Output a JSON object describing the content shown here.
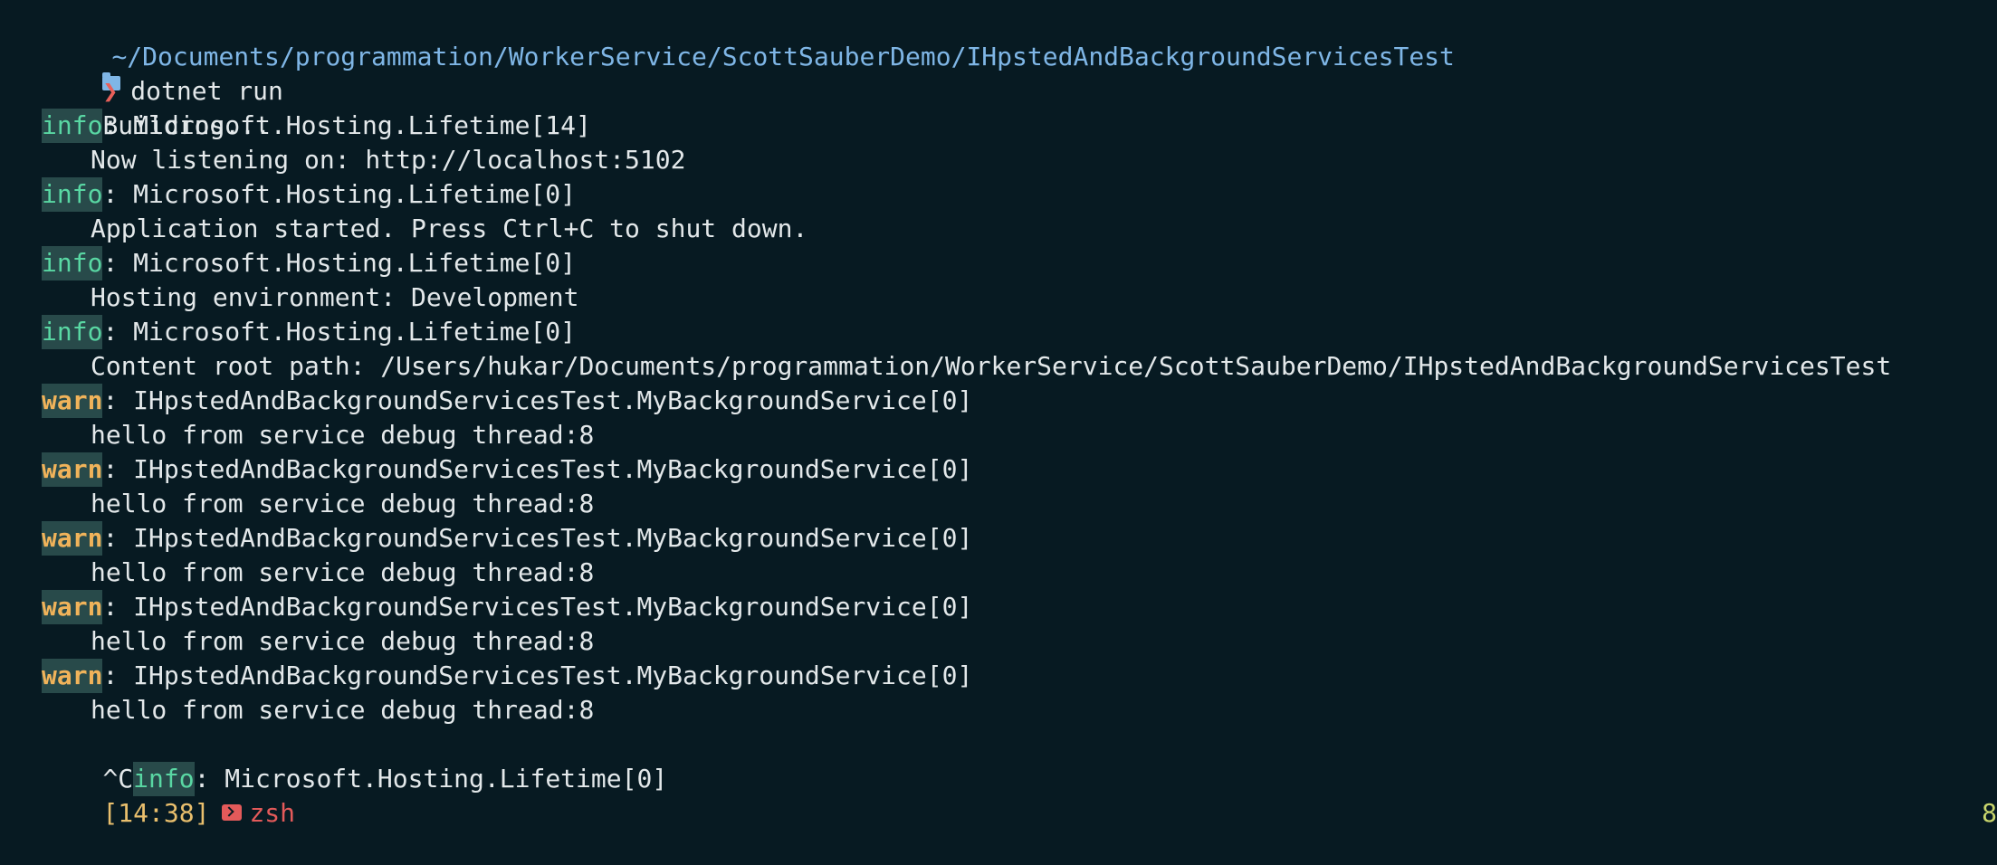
{
  "prompt": {
    "cwd": "~/Documents/programmation/WorkerService/ScottSauberDemo/IHpstedAndBackgroundServicesTest",
    "chevron": "❯",
    "command": "dotnet run"
  },
  "output": {
    "building": "Building...",
    "entries": [
      {
        "level": "info",
        "source": ": Microsoft.Hosting.Lifetime[14]",
        "message": "Now listening on: http://localhost:5102"
      },
      {
        "level": "info",
        "source": ": Microsoft.Hosting.Lifetime[0]",
        "message": "Application started. Press Ctrl+C to shut down."
      },
      {
        "level": "info",
        "source": ": Microsoft.Hosting.Lifetime[0]",
        "message": "Hosting environment: Development"
      },
      {
        "level": "info",
        "source": ": Microsoft.Hosting.Lifetime[0]",
        "message": "Content root path: /Users/hukar/Documents/programmation/WorkerService/ScottSauberDemo/IHpstedAndBackgroundServicesTest"
      },
      {
        "level": "warn",
        "source": ": IHpstedAndBackgroundServicesTest.MyBackgroundService[0]",
        "message": "hello from service debug thread:8"
      },
      {
        "level": "warn",
        "source": ": IHpstedAndBackgroundServicesTest.MyBackgroundService[0]",
        "message": "hello from service debug thread:8"
      },
      {
        "level": "warn",
        "source": ": IHpstedAndBackgroundServicesTest.MyBackgroundService[0]",
        "message": "hello from service debug thread:8"
      },
      {
        "level": "warn",
        "source": ": IHpstedAndBackgroundServicesTest.MyBackgroundService[0]",
        "message": "hello from service debug thread:8"
      },
      {
        "level": "warn",
        "source": ": IHpstedAndBackgroundServicesTest.MyBackgroundService[0]",
        "message": "hello from service debug thread:8"
      }
    ],
    "interrupt": {
      "prefix": "^C",
      "level": "info",
      "source": ": Microsoft.Hosting.Lifetime[0]"
    }
  },
  "status_bar": {
    "time": "[14:38]",
    "shell": "zsh",
    "right_value": "8"
  },
  "colors": {
    "background": "#071a22",
    "info": "#59d7a3",
    "warn": "#f0b35a",
    "path": "#7fb6e6",
    "accent_red": "#e35a5a"
  },
  "icons": {
    "folder": "folder-icon",
    "status_dot": "status-dot-icon",
    "prompt": "chevron-right-icon",
    "shell": "terminal-icon"
  }
}
